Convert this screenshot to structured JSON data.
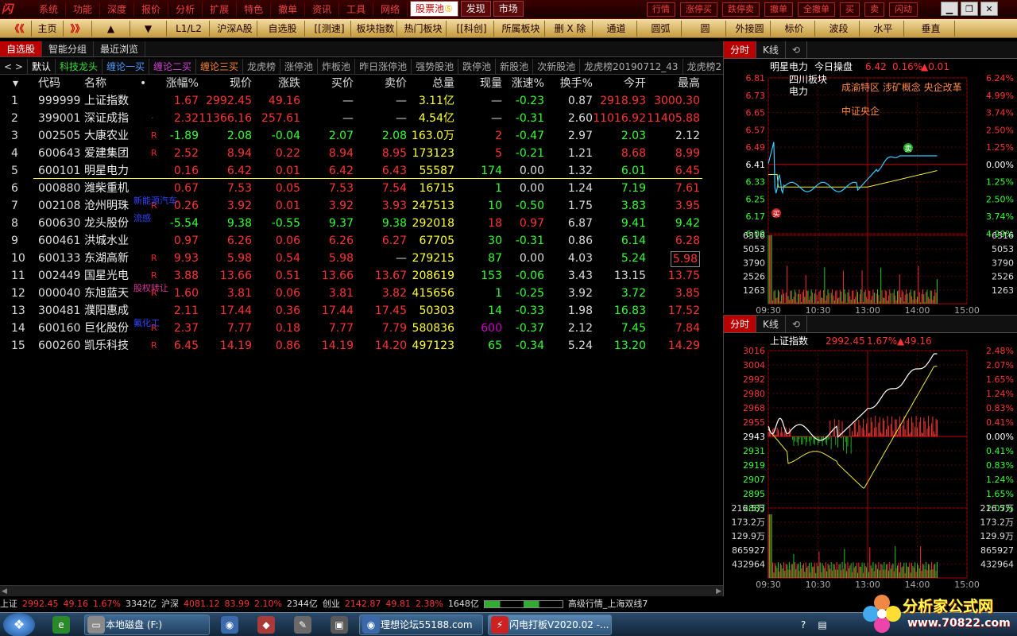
{
  "menu": {
    "logo": "闪",
    "left": [
      "系统",
      "功能",
      "深度",
      "报价",
      "分析",
      "扩展",
      "特色",
      "撤单",
      "资讯",
      "工具",
      "网络"
    ],
    "tabs": [
      "股票池",
      "发现",
      "市场"
    ],
    "stock_pool_badge": "⑤",
    "right": [
      "行情",
      "涨停买",
      "跌停卖",
      "撤单",
      "全撤单",
      "买",
      "卖",
      "闪动"
    ],
    "window_controls": [
      "▁",
      "❐",
      "✕"
    ]
  },
  "toolbar": {
    "back": "《《",
    "home": "主页",
    "forward": "》》",
    "up": "▲",
    "down": "▼",
    "items": [
      "L1/L2",
      "沪深A股",
      "自选股",
      "[[测速]",
      "板块指数",
      "热门板块",
      "[[科创]",
      "所属板块",
      "删 X 除",
      "通道",
      "圆弧",
      "圆",
      "外接圆",
      "标价",
      "波段",
      "水平",
      "垂直"
    ]
  },
  "subtabs": [
    "自选股",
    "智能分组",
    "最近浏览"
  ],
  "grouptabs": {
    "arrows": "< >",
    "items": [
      {
        "label": "默认",
        "color": "#ffffff"
      },
      {
        "label": "科技龙头",
        "color": "#33dd33"
      },
      {
        "label": "缠论一买",
        "color": "#4a9bff"
      },
      {
        "label": "缠论二买",
        "color": "#d040d0"
      },
      {
        "label": "缠论三买",
        "color": "#ff8030"
      },
      {
        "label": "龙虎榜",
        "color": "#aaaaaa"
      },
      {
        "label": "涨停池",
        "color": "#aaaaaa"
      },
      {
        "label": "炸板池",
        "color": "#aaaaaa"
      },
      {
        "label": "昨日涨停池",
        "color": "#aaaaaa"
      },
      {
        "label": "强势股池",
        "color": "#aaaaaa"
      },
      {
        "label": "跌停池",
        "color": "#aaaaaa"
      },
      {
        "label": "新股池",
        "color": "#aaaaaa"
      },
      {
        "label": "次新股池",
        "color": "#aaaaaa"
      },
      {
        "label": "龙虎榜20190712_43",
        "color": "#aaaaaa"
      },
      {
        "label": "龙虎榜2",
        "color": "#aaaaaa"
      }
    ]
  },
  "table": {
    "sort_icon": "▾",
    "headers": [
      "代码",
      "名称",
      "•",
      "涨幅%",
      "现价",
      "涨跌",
      "买价",
      "卖价",
      "总量",
      "现量",
      "涨速%",
      "换手%",
      "今开",
      "最高"
    ],
    "rows": [
      {
        "i": "1",
        "code": "999999",
        "name": "上证指数",
        "flag": "",
        "note": "",
        "v": [
          "1.67",
          "2992.45",
          "49.16",
          "—",
          "—",
          "3.11亿",
          "—",
          "-0.23",
          "0.87",
          "2918.93",
          "3000.30"
        ],
        "c": [
          "red",
          "red",
          "red",
          "white",
          "white",
          "yellow",
          "white",
          "green",
          "white",
          "red",
          "red"
        ]
      },
      {
        "i": "2",
        "code": "399001",
        "name": "深证成指",
        "flag": "·",
        "note": "",
        "v": [
          "2.32",
          "11366.16",
          "257.61",
          "—",
          "—",
          "4.54亿",
          "—",
          "-0.31",
          "2.60",
          "11016.92",
          "11405.88"
        ],
        "c": [
          "red",
          "red",
          "red",
          "white",
          "white",
          "yellow",
          "white",
          "green",
          "white",
          "red",
          "red"
        ]
      },
      {
        "i": "3",
        "code": "002505",
        "name": "大康农业",
        "flag": "R",
        "note": "",
        "v": [
          "-1.89",
          "2.08",
          "-0.04",
          "2.07",
          "2.08",
          "163.0万",
          "2",
          "-0.47",
          "2.97",
          "2.03",
          "2.12"
        ],
        "c": [
          "green",
          "green",
          "green",
          "green",
          "green",
          "yellow",
          "red",
          "green",
          "white",
          "green",
          "white"
        ]
      },
      {
        "i": "4",
        "code": "600643",
        "name": "爱建集团",
        "flag": "R",
        "note": "",
        "v": [
          "2.52",
          "8.94",
          "0.22",
          "8.94",
          "8.95",
          "173123",
          "5",
          "-0.21",
          "1.21",
          "8.68",
          "8.99"
        ],
        "c": [
          "red",
          "red",
          "red",
          "red",
          "red",
          "yellow",
          "red",
          "green",
          "white",
          "red",
          "red"
        ]
      },
      {
        "i": "5",
        "code": "600101",
        "name": "明星电力",
        "flag": "",
        "note": "",
        "v": [
          "0.16",
          "6.42",
          "0.01",
          "6.42",
          "6.43",
          "55587",
          "174",
          "0.00",
          "1.32",
          "6.01",
          "6.45"
        ],
        "c": [
          "red",
          "red",
          "red",
          "red",
          "red",
          "yellow",
          "green",
          "white",
          "white",
          "green",
          "red"
        ]
      },
      {
        "i": "6",
        "code": "000880",
        "name": "潍柴重机",
        "flag": "",
        "note": "",
        "v": [
          "0.67",
          "7.53",
          "0.05",
          "7.53",
          "7.54",
          "16715",
          "1",
          "0.00",
          "1.24",
          "7.19",
          "7.61"
        ],
        "c": [
          "red",
          "red",
          "red",
          "red",
          "red",
          "yellow",
          "green",
          "white",
          "white",
          "green",
          "red"
        ]
      },
      {
        "i": "7",
        "code": "002108",
        "name": "沧州明珠",
        "flag": "R",
        "note": "新能源汽车",
        "noteColor": "#3344ff",
        "v": [
          "0.26",
          "3.92",
          "0.01",
          "3.92",
          "3.93",
          "247513",
          "10",
          "-0.50",
          "1.75",
          "3.83",
          "3.95"
        ],
        "c": [
          "red",
          "red",
          "red",
          "red",
          "red",
          "yellow",
          "green",
          "green",
          "white",
          "green",
          "red"
        ]
      },
      {
        "i": "8",
        "code": "600630",
        "name": "龙头股份",
        "flag": "",
        "note": "流感",
        "noteColor": "#3344ff",
        "v": [
          "-5.54",
          "9.38",
          "-0.55",
          "9.37",
          "9.38",
          "292018",
          "18",
          "0.97",
          "6.87",
          "9.41",
          "9.42"
        ],
        "c": [
          "green",
          "green",
          "green",
          "green",
          "green",
          "yellow",
          "red",
          "red",
          "white",
          "green",
          "green"
        ]
      },
      {
        "i": "9",
        "code": "600461",
        "name": "洪城水业",
        "flag": "",
        "note": "",
        "v": [
          "0.97",
          "6.26",
          "0.06",
          "6.26",
          "6.27",
          "67705",
          "30",
          "-0.31",
          "0.86",
          "6.14",
          "6.28"
        ],
        "c": [
          "red",
          "red",
          "red",
          "red",
          "red",
          "yellow",
          "green",
          "green",
          "white",
          "green",
          "red"
        ]
      },
      {
        "i": "10",
        "code": "600133",
        "name": "东湖高新",
        "flag": "R",
        "note": "",
        "v": [
          "9.93",
          "5.98",
          "0.54",
          "5.98",
          "—",
          "279215",
          "87",
          "0.00",
          "4.03",
          "5.24",
          "5.98"
        ],
        "c": [
          "red",
          "red",
          "red",
          "red",
          "white",
          "yellow",
          "green",
          "white",
          "white",
          "green",
          "red"
        ]
      },
      {
        "i": "11",
        "code": "002449",
        "name": "国星光电",
        "flag": "R",
        "note": "",
        "v": [
          "3.88",
          "13.66",
          "0.51",
          "13.66",
          "13.67",
          "208619",
          "153",
          "-0.06",
          "3.43",
          "13.15",
          "13.75"
        ],
        "c": [
          "red",
          "red",
          "red",
          "red",
          "red",
          "yellow",
          "green",
          "green",
          "white",
          "white",
          "red"
        ]
      },
      {
        "i": "12",
        "code": "000040",
        "name": "东旭蓝天",
        "flag": "R",
        "note": "股权转让",
        "noteColor": "#dd3399",
        "v": [
          "1.60",
          "3.81",
          "0.06",
          "3.81",
          "3.82",
          "415656",
          "1",
          "-0.25",
          "3.92",
          "3.72",
          "3.85"
        ],
        "c": [
          "red",
          "red",
          "red",
          "red",
          "red",
          "yellow",
          "green",
          "green",
          "white",
          "green",
          "red"
        ]
      },
      {
        "i": "13",
        "code": "300481",
        "name": "濮阳惠成",
        "flag": "",
        "note": "",
        "v": [
          "2.11",
          "17.44",
          "0.36",
          "17.44",
          "17.45",
          "50303",
          "14",
          "-0.33",
          "1.98",
          "16.83",
          "17.52"
        ],
        "c": [
          "red",
          "red",
          "red",
          "red",
          "red",
          "yellow",
          "green",
          "green",
          "white",
          "green",
          "red"
        ]
      },
      {
        "i": "14",
        "code": "600160",
        "name": "巨化股份",
        "flag": "R",
        "note": "氟化工",
        "noteColor": "#3344ff",
        "v": [
          "2.37",
          "7.77",
          "0.18",
          "7.77",
          "7.79",
          "580836",
          "600",
          "-0.37",
          "2.12",
          "7.45",
          "7.84"
        ],
        "c": [
          "red",
          "red",
          "red",
          "red",
          "red",
          "yellow",
          "purple",
          "green",
          "white",
          "green",
          "red"
        ]
      },
      {
        "i": "15",
        "code": "600260",
        "name": "凯乐科技",
        "flag": "R",
        "note": "",
        "v": [
          "6.45",
          "14.19",
          "0.86",
          "14.19",
          "14.20",
          "497123",
          "65",
          "-0.34",
          "5.24",
          "13.20",
          "14.29"
        ],
        "c": [
          "red",
          "red",
          "red",
          "red",
          "red",
          "yellow",
          "green",
          "green",
          "white",
          "green",
          "red"
        ]
      }
    ]
  },
  "status": [
    {
      "t": "上证",
      "c": "#dddddd"
    },
    {
      "t": "2992.45",
      "c": "#ff3333"
    },
    {
      "t": "49.16",
      "c": "#ff3333"
    },
    {
      "t": "1.67%",
      "c": "#ff3333"
    },
    {
      "t": "3342亿",
      "c": "#dddddd"
    },
    {
      "t": "沪深",
      "c": "#dddddd"
    },
    {
      "t": "4081.12",
      "c": "#ff3333"
    },
    {
      "t": "83.99",
      "c": "#ff3333"
    },
    {
      "t": "2.10%",
      "c": "#ff3333"
    },
    {
      "t": "2344亿",
      "c": "#dddddd"
    },
    {
      "t": "创业",
      "c": "#dddddd"
    },
    {
      "t": "2142.87",
      "c": "#ff3333"
    },
    {
      "t": "49.81",
      "c": "#ff3333"
    },
    {
      "t": "2.38%",
      "c": "#ff3333"
    },
    {
      "t": "1648亿",
      "c": "#dddddd"
    },
    {
      "t": "高级行情_上海双线7",
      "c": "#dddddd"
    }
  ],
  "panel1": {
    "tabs": [
      "分时",
      "K线"
    ],
    "stock_name": "明星电力",
    "tag": "今日操盘",
    "price": "6.42",
    "pct": "0.16%",
    "change": "▲0.01",
    "concepts": [
      "四川板块",
      "电力",
      "成渝特区 涉矿概念 央企改革",
      "中证央企"
    ],
    "marker": "买",
    "marker2": "卖",
    "price_labels": [
      "6.81",
      "6.73",
      "6.65",
      "6.57",
      "6.49",
      "6.41",
      "6.33",
      "6.25",
      "6.17",
      "6.09"
    ],
    "pct_labels": [
      "6.24%",
      "4.99%",
      "3.74%",
      "2.50%",
      "1.25%",
      "0.00%",
      "1.25%",
      "2.50%",
      "3.74%",
      "4.99%"
    ],
    "vol_labels": [
      "6316",
      "5053",
      "3790",
      "2526",
      "1263"
    ],
    "time_labels": [
      "09:30",
      "10:30",
      "13:00",
      "14:00",
      "15:00"
    ]
  },
  "panel2": {
    "tabs": [
      "分时",
      "K线"
    ],
    "stock_name": "上证指数",
    "price": "2992.45",
    "pct": "1.67%",
    "change": "▲49.16",
    "price_labels": [
      "3016",
      "3004",
      "2992",
      "2980",
      "2968",
      "2955",
      "2943",
      "2931",
      "2919",
      "2907",
      "2895",
      "2883"
    ],
    "pct_labels": [
      "2.48%",
      "2.07%",
      "1.65%",
      "1.24%",
      "0.83%",
      "0.41%",
      "0.00%",
      "0.41%",
      "0.83%",
      "1.24%",
      "1.65%",
      "2.07%"
    ],
    "vol_labels": [
      "216.5万",
      "173.2万",
      "129.9万",
      "865927",
      "432964"
    ],
    "time_labels": [
      "09:30",
      "10:30",
      "13:00",
      "14:00",
      "15:00"
    ]
  },
  "taskbar": {
    "items": [
      "本地磁盘 (F:)",
      "理想论坛55188.com",
      "闪电打板V2020.02 -..."
    ],
    "brand": "分析家公式网",
    "brand_url": "www.70822.com"
  }
}
